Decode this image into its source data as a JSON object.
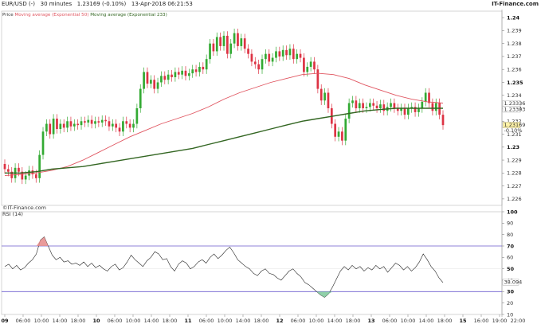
{
  "header": {
    "symbol": "EUR/USD (-)",
    "interval": "30 minutes",
    "last_change": "1.23169 (-0.10%)",
    "datetime": "13-Apr-2018 06:21:53",
    "brand": "IT-Finance.com"
  },
  "legend": {
    "price": "Price",
    "ma50": "Moving average (Exponential 50)",
    "ma233": "Moving average (Exponential 233)"
  },
  "watermark": "©IT-Finance.com",
  "rsi_label": "RSI (14)",
  "colors": {
    "up": "#33aa33",
    "down": "#dd3344",
    "ma50": "#e05560",
    "ma233": "#336622",
    "rsi_band": "#6a5acd",
    "rsi_line": "#222222"
  },
  "price_callouts": {
    "ma50_value": "1.23336",
    "ma233_value": "1.23303",
    "last_price": "1.23169",
    "last_change": "-0.10%"
  },
  "rsi_callout": "38.094",
  "chart_data": [
    {
      "type": "candlestick",
      "title": "EUR/USD (-) 30 minutes",
      "ylim": [
        1.2255,
        1.2405
      ],
      "y_ticks": [
        "1.24",
        "1.239",
        "1.238",
        "1.237",
        "1.236",
        "1.235",
        "1.234",
        "1.233",
        "1.232",
        "1.231",
        "1.23",
        "1.229",
        "1.228",
        "1.227",
        "1.226"
      ],
      "y_ticks_bold": [
        "1.24",
        "1.235",
        "1.23"
      ],
      "x_ticks": [
        "09",
        "06:00",
        "10:00",
        "14:00",
        "18:00",
        "10",
        "06:00",
        "10:00",
        "14:00",
        "18:00",
        "11",
        "06:00",
        "10:00",
        "14:00",
        "18:00",
        "12",
        "06:00",
        "10:00",
        "14:00",
        "18:00",
        "13",
        "06:00",
        "10:00",
        "14:00",
        "18:00",
        "15",
        "16:00",
        "19:00",
        "22:00"
      ],
      "x_ticks_bold": [
        "09",
        "10",
        "11",
        "12",
        "13",
        "15"
      ],
      "close_path": [
        1.2283,
        1.2281,
        1.2276,
        1.2284,
        1.2281,
        1.2275,
        1.2278,
        1.2282,
        1.2279,
        1.2276,
        1.2294,
        1.2312,
        1.2318,
        1.231,
        1.2322,
        1.2314,
        1.2318,
        1.2315,
        1.232,
        1.2316,
        1.2318,
        1.2317,
        1.232,
        1.2319,
        1.2321,
        1.2318,
        1.232,
        1.2319,
        1.2321,
        1.232,
        1.2316,
        1.2318,
        1.2315,
        1.2312,
        1.232,
        1.2318,
        1.2315,
        1.2318,
        1.233,
        1.2345,
        1.2358,
        1.2349,
        1.2352,
        1.2345,
        1.235,
        1.2355,
        1.2352,
        1.2356,
        1.2354,
        1.2358,
        1.2356,
        1.2359,
        1.2355,
        1.2357,
        1.236,
        1.2358,
        1.2362,
        1.236,
        1.2368,
        1.238,
        1.2374,
        1.2385,
        1.2378,
        1.2386,
        1.2372,
        1.238,
        1.2388,
        1.2378,
        1.2384,
        1.2376,
        1.2372,
        1.2366,
        1.2364,
        1.236,
        1.2368,
        1.2372,
        1.2366,
        1.2369,
        1.2374,
        1.237,
        1.2375,
        1.2371,
        1.2376,
        1.2368,
        1.2372,
        1.2369,
        1.2358,
        1.2362,
        1.2366,
        1.236,
        1.2345,
        1.2336,
        1.2342,
        1.233,
        1.2318,
        1.2308,
        1.2312,
        1.2305,
        1.2322,
        1.2334,
        1.2336,
        1.233,
        1.2334,
        1.233,
        1.2331,
        1.2334,
        1.2332,
        1.233,
        1.2333,
        1.2328,
        1.2331,
        1.2334,
        1.233,
        1.2328,
        1.233,
        1.2325,
        1.233,
        1.2331,
        1.2327,
        1.233,
        1.2335,
        1.2342,
        1.2334,
        1.2328,
        1.2334,
        1.2325,
        1.2317
      ],
      "series": [
        {
          "name": "Moving average (Exponential 50)",
          "values": [
            1.2278,
            1.2279,
            1.228,
            1.2282,
            1.2285,
            1.229,
            1.2296,
            1.2302,
            1.2308,
            1.2313,
            1.2318,
            1.2322,
            1.2326,
            1.2331,
            1.2337,
            1.2342,
            1.2346,
            1.235,
            1.2353,
            1.2356,
            1.2357,
            1.2356,
            1.2353,
            1.2348,
            1.2344,
            1.234,
            1.2337,
            1.2335,
            1.2334
          ]
        },
        {
          "name": "Moving average (Exponential 233)",
          "values": [
            1.228,
            1.228,
            1.2281,
            1.2283,
            1.2284,
            1.2285,
            1.2287,
            1.2289,
            1.2291,
            1.2293,
            1.2295,
            1.2297,
            1.2299,
            1.2302,
            1.2305,
            1.2308,
            1.2311,
            1.2314,
            1.2317,
            1.232,
            1.2322,
            1.2324,
            1.2326,
            1.2328,
            1.2329,
            1.233,
            1.233,
            1.233,
            1.233
          ]
        }
      ]
    },
    {
      "type": "line",
      "title": "RSI (14)",
      "ylim": [
        10,
        100
      ],
      "y_ticks": [
        "100",
        "90",
        "80",
        "70",
        "60",
        "50",
        "40",
        "30",
        "20",
        "10"
      ],
      "y_ticks_bold": [
        "100",
        "70",
        "50",
        "30"
      ],
      "bands": [
        70,
        30
      ],
      "series": [
        {
          "name": "RSI (14)",
          "values": [
            52,
            54,
            50,
            53,
            49,
            51,
            55,
            58,
            63,
            75,
            78,
            70,
            62,
            58,
            60,
            56,
            57,
            54,
            55,
            53,
            56,
            52,
            55,
            51,
            53,
            50,
            48,
            52,
            54,
            49,
            51,
            56,
            62,
            58,
            55,
            52,
            57,
            60,
            65,
            63,
            58,
            59,
            52,
            48,
            54,
            57,
            55,
            50,
            52,
            56,
            58,
            55,
            60,
            63,
            59,
            62,
            66,
            69,
            64,
            58,
            55,
            52,
            50,
            46,
            44,
            48,
            50,
            46,
            45,
            42,
            40,
            44,
            48,
            50,
            46,
            43,
            38,
            36,
            33,
            30,
            27,
            25,
            28,
            34,
            41,
            48,
            52,
            49,
            53,
            50,
            52,
            48,
            51,
            49,
            53,
            50,
            52,
            47,
            51,
            55,
            53,
            49,
            52,
            48,
            51,
            56,
            63,
            58,
            52,
            48,
            42,
            38
          ]
        }
      ]
    }
  ]
}
